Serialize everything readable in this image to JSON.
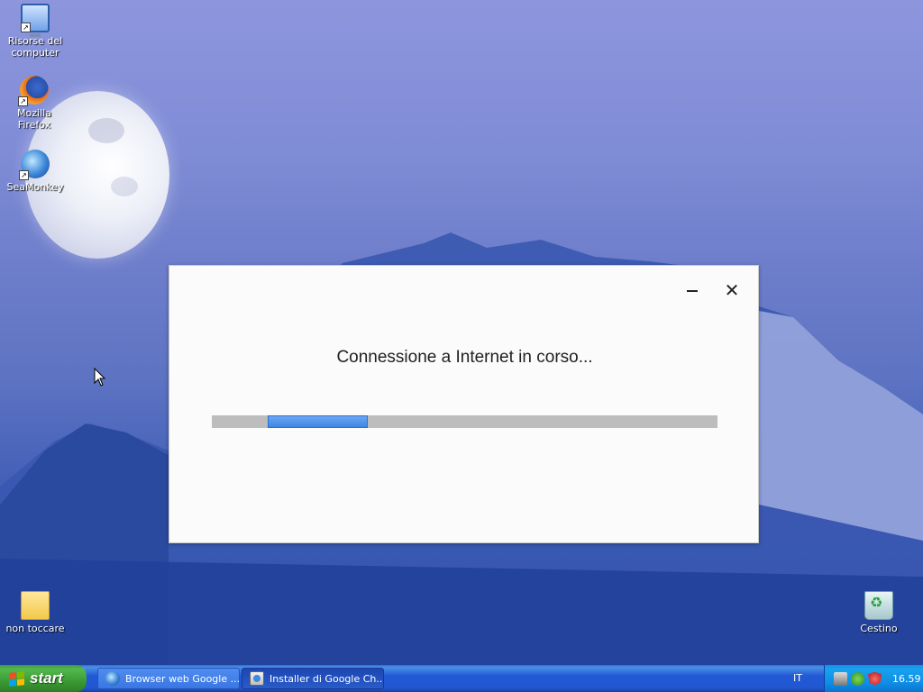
{
  "desktop": {
    "icons": [
      {
        "label_line1": "Risorse del",
        "label_line2": "computer",
        "icon": "my-computer-icon"
      },
      {
        "label": "Mozilla Firefox",
        "icon": "firefox-icon"
      },
      {
        "label": "SeaMonkey",
        "icon": "seamonkey-icon"
      },
      {
        "label": "non toccare",
        "icon": "folder-icon"
      },
      {
        "label": "Cestino",
        "icon": "recycle-bin-icon"
      }
    ]
  },
  "dialog": {
    "message": "Connessione a Internet in corso...",
    "minimize_symbol": "–",
    "close_symbol": "✕",
    "progress": {
      "indeterminate": true,
      "fill_color": "#3f86e6",
      "track_color": "#bdbdbd"
    }
  },
  "taskbar": {
    "start_label": "start",
    "tasks": [
      {
        "label": "Browser web Google ...",
        "icon": "seamonkey-icon",
        "active": false
      },
      {
        "label": "Installer di Google Ch...",
        "icon": "installer-icon",
        "active": true
      }
    ],
    "language": "IT",
    "tray_icons": [
      "network-icon",
      "shield-icon",
      "antivirus-icon"
    ],
    "clock": "16.59"
  },
  "colors": {
    "taskbar_blue": "#2358d6",
    "start_green": "#3b9a34",
    "tray_blue": "#0f8be3",
    "dialog_bg": "#fbfbfb"
  }
}
